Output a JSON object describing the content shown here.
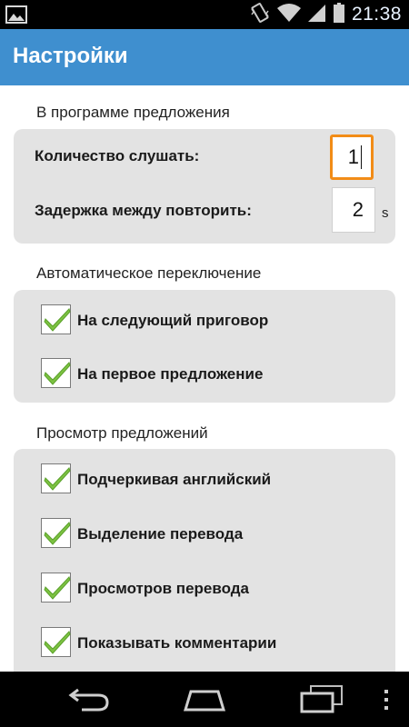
{
  "status_bar": {
    "time": "21:38",
    "icons": [
      "gallery-icon",
      "vibrate-icon",
      "wifi-icon",
      "signal-icon",
      "battery-icon"
    ]
  },
  "app_bar": {
    "title": "Настройки"
  },
  "sections": [
    {
      "title": "В программе предложения",
      "rows": [
        {
          "label": "Количество слушать:",
          "value": "1"
        },
        {
          "label": "Задержка между повторить:",
          "value": "2",
          "unit": "s"
        }
      ]
    },
    {
      "title": "Автоматическое переключение",
      "options": [
        {
          "label": "На следующий приговор",
          "checked": true
        },
        {
          "label": "На первое предложение",
          "checked": true
        }
      ]
    },
    {
      "title": "Просмотр предложений",
      "options": [
        {
          "label": "Подчеркивая английский",
          "checked": true
        },
        {
          "label": "Выделение перевода",
          "checked": true
        },
        {
          "label": "Просмотров перевода",
          "checked": true
        },
        {
          "label": "Показывать комментарии",
          "checked": true
        }
      ]
    }
  ],
  "nav_bar": {
    "buttons": [
      "back-icon",
      "home-icon",
      "recent-apps-icon"
    ]
  },
  "colors": {
    "app_bar": "#3f8fcf",
    "card": "#e3e3e3",
    "focus": "#f28c17",
    "check": "#7dc242"
  }
}
